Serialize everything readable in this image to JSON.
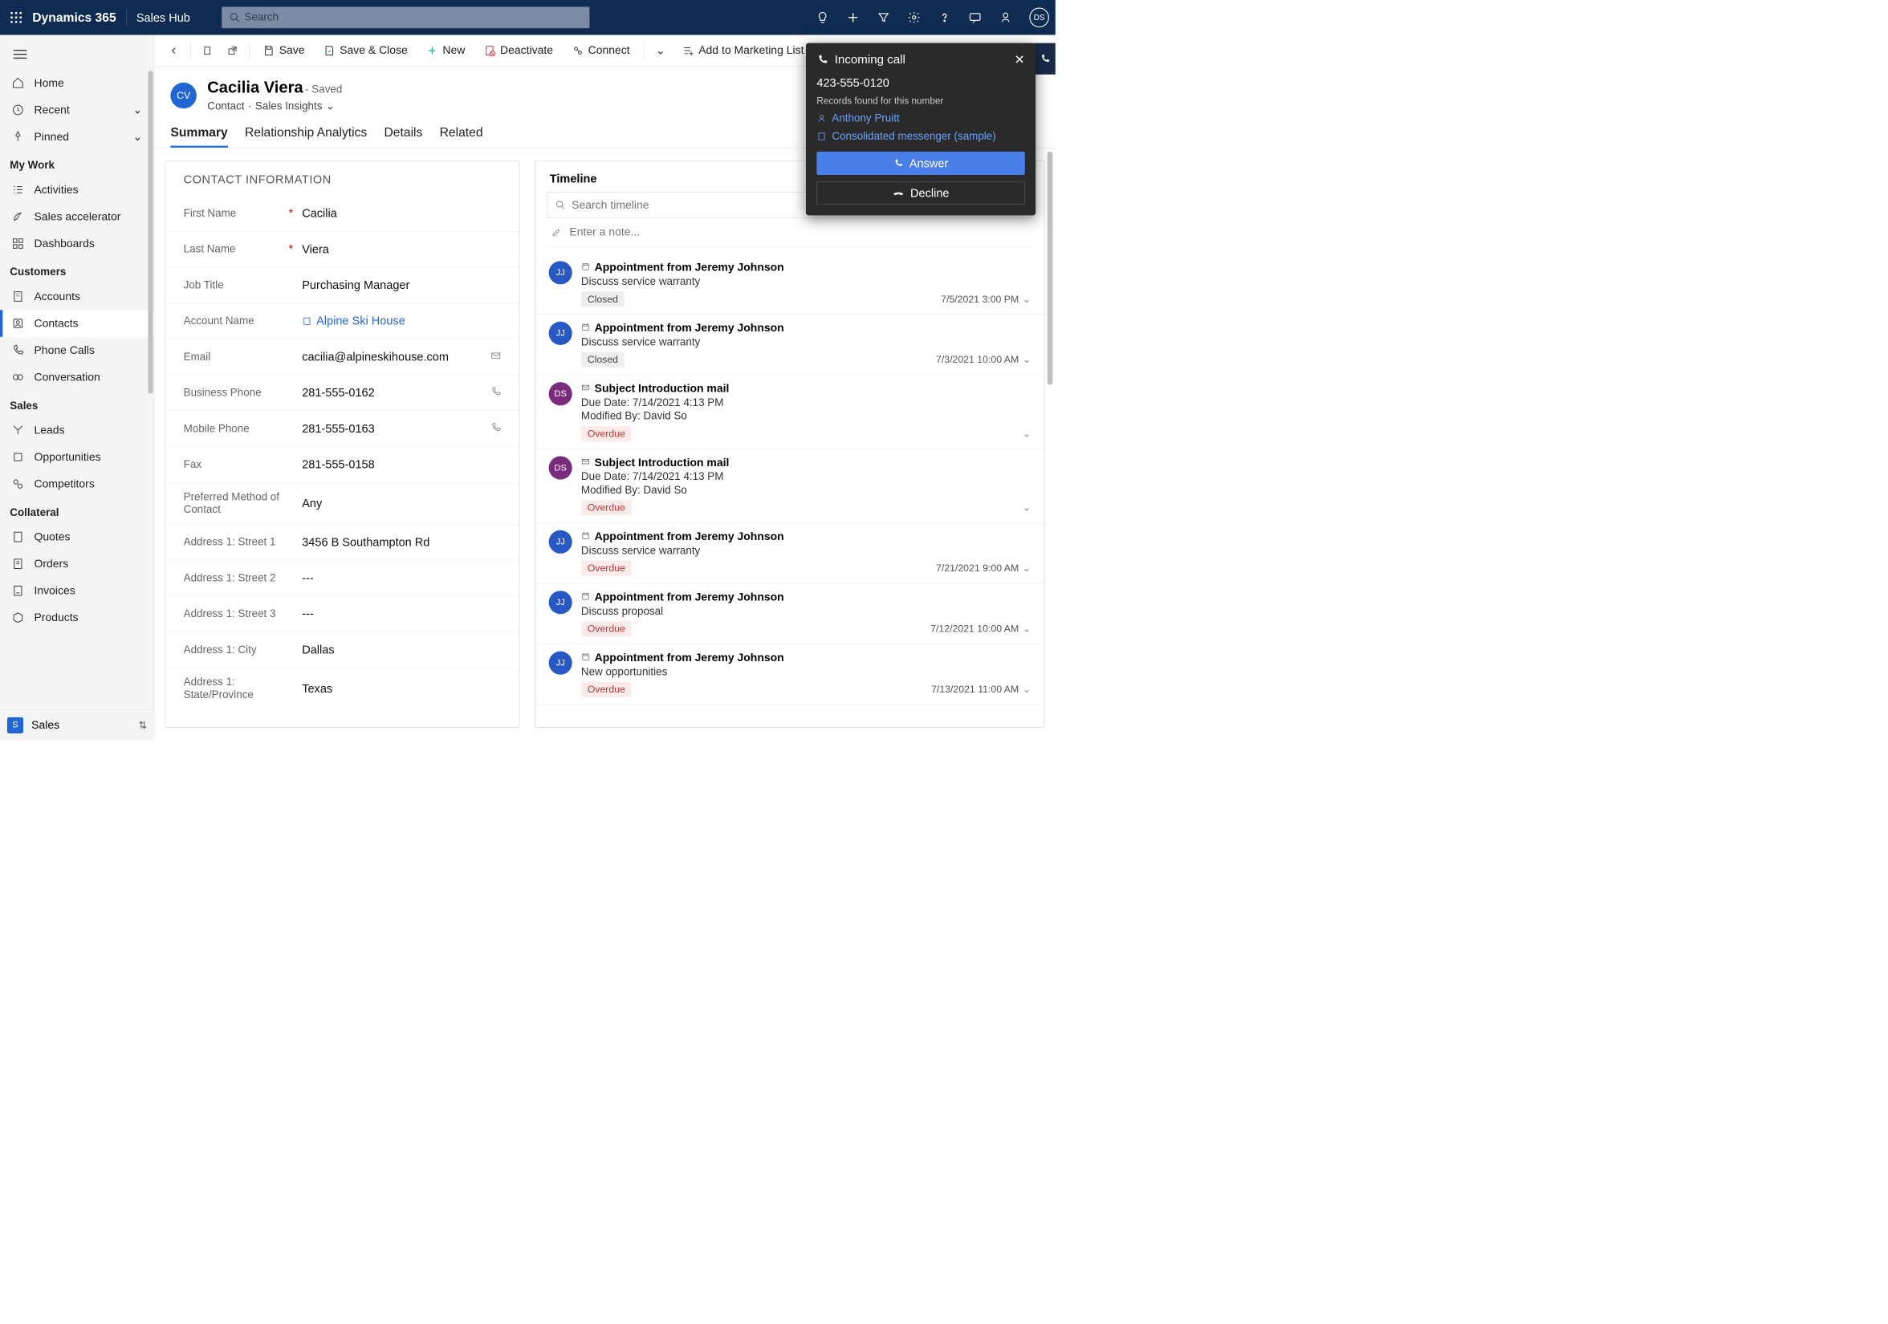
{
  "topbar": {
    "app": "Dynamics 365",
    "hub": "Sales Hub",
    "search_placeholder": "Search",
    "avatar": "DS"
  },
  "sidebar": {
    "home": "Home",
    "recent": "Recent",
    "pinned": "Pinned",
    "sections": {
      "mywork": {
        "header": "My Work",
        "items": [
          "Activities",
          "Sales accelerator",
          "Dashboards"
        ]
      },
      "customers": {
        "header": "Customers",
        "items": [
          "Accounts",
          "Contacts",
          "Phone Calls",
          "Conversation"
        ],
        "active_index": 1
      },
      "sales": {
        "header": "Sales",
        "items": [
          "Leads",
          "Opportunities",
          "Competitors"
        ]
      },
      "collateral": {
        "header": "Collateral",
        "items": [
          "Quotes",
          "Orders",
          "Invoices",
          "Products"
        ]
      }
    },
    "footer": {
      "badge": "S",
      "label": "Sales"
    }
  },
  "commands": {
    "save": "Save",
    "save_close": "Save & Close",
    "new": "New",
    "deactivate": "Deactivate",
    "connect": "Connect",
    "add_marketing": "Add to Marketing List"
  },
  "record": {
    "avatar": "CV",
    "name": "Cacilia Viera",
    "saved": "- Saved",
    "entity": "Contact",
    "form": "Sales Insights"
  },
  "tabs": [
    "Summary",
    "Relationship Analytics",
    "Details",
    "Related"
  ],
  "contact_card_title": "CONTACT INFORMATION",
  "fields": {
    "first_name": {
      "label": "First Name",
      "value": "Cacilia"
    },
    "last_name": {
      "label": "Last Name",
      "value": "Viera"
    },
    "job_title": {
      "label": "Job Title",
      "value": "Purchasing Manager"
    },
    "account": {
      "label": "Account Name",
      "value": "Alpine Ski House"
    },
    "email": {
      "label": "Email",
      "value": "cacilia@alpineskihouse.com"
    },
    "bphone": {
      "label": "Business Phone",
      "value": "281-555-0162"
    },
    "mphone": {
      "label": "Mobile Phone",
      "value": "281-555-0163"
    },
    "fax": {
      "label": "Fax",
      "value": "281-555-0158"
    },
    "pref": {
      "label": "Preferred Method of Contact",
      "value": "Any"
    },
    "street1": {
      "label": "Address 1: Street 1",
      "value": "3456 B Southampton Rd"
    },
    "street2": {
      "label": "Address 1: Street 2",
      "value": "---"
    },
    "street3": {
      "label": "Address 1: Street 3",
      "value": "---"
    },
    "city": {
      "label": "Address 1: City",
      "value": "Dallas"
    },
    "state": {
      "label": "Address 1: State/Province",
      "value": "Texas"
    }
  },
  "timeline": {
    "header": "Timeline",
    "search_placeholder": "Search timeline",
    "note_placeholder": "Enter a note...",
    "items": [
      {
        "avatar": "JJ",
        "av_class": "jj",
        "icon": "cal",
        "title": "Appointment from Jeremy Johnson",
        "desc": "Discuss service warranty",
        "badge": "Closed",
        "badge_class": "closed",
        "date": "7/5/2021 3:00 PM"
      },
      {
        "avatar": "JJ",
        "av_class": "jj",
        "icon": "cal",
        "title": "Appointment from Jeremy Johnson",
        "desc": "Discuss service warranty",
        "badge": "Closed",
        "badge_class": "closed",
        "date": "7/3/2021 10:00 AM"
      },
      {
        "avatar": "DS",
        "av_class": "ds",
        "icon": "mail",
        "title": "Subject Introduction mail",
        "desc": "Due Date: 7/14/2021 4:13 PM",
        "meta": "Modified By: David So",
        "badge": "Overdue",
        "badge_class": "overdue",
        "date": ""
      },
      {
        "avatar": "DS",
        "av_class": "ds",
        "icon": "mail",
        "title": "Subject Introduction mail",
        "desc": "Due Date: 7/14/2021 4:13 PM",
        "meta": "Modified By: David So",
        "badge": "Overdue",
        "badge_class": "overdue",
        "date": ""
      },
      {
        "avatar": "JJ",
        "av_class": "jj",
        "icon": "cal",
        "title": "Appointment from Jeremy Johnson",
        "desc": "Discuss service warranty",
        "badge": "Overdue",
        "badge_class": "overdue",
        "date": "7/21/2021 9:00 AM"
      },
      {
        "avatar": "JJ",
        "av_class": "jj",
        "icon": "cal",
        "title": "Appointment from Jeremy Johnson",
        "desc": "Discuss proposal",
        "badge": "Overdue",
        "badge_class": "overdue",
        "date": "7/12/2021 10:00 AM"
      },
      {
        "avatar": "JJ",
        "av_class": "jj",
        "icon": "cal",
        "title": "Appointment from Jeremy Johnson",
        "desc": "New opportunities",
        "badge": "Overdue",
        "badge_class": "overdue",
        "date": "7/13/2021 11:00 AM"
      }
    ]
  },
  "call": {
    "title": "Incoming call",
    "number": "423-555-0120",
    "records_found": "Records found for this number",
    "person": "Anthony Pruitt",
    "account": "Consolidated messenger (sample)",
    "answer": "Answer",
    "decline": "Decline"
  }
}
